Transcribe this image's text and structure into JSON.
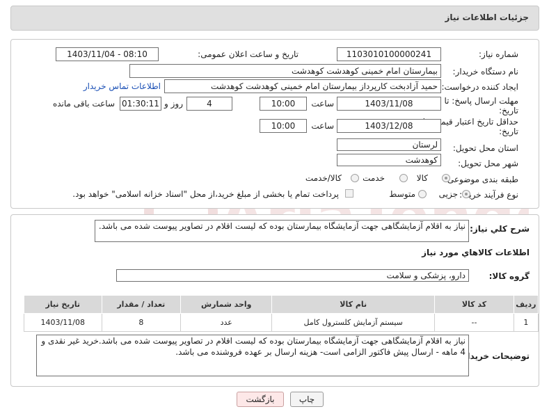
{
  "header": {
    "title": "جزئیات اطلاعات نیاز"
  },
  "form": {
    "need_number": {
      "label": "شماره نیاز:",
      "value": "1103010100000241"
    },
    "announce_datetime": {
      "label": "تاریخ و ساعت اعلان عمومی:",
      "value": "1403/11/04 - 08:10"
    },
    "buyer_org": {
      "label": "نام دستگاه خریدار:",
      "value": "بیمارستان امام خمینی کوهدشت کوهدشت"
    },
    "requester": {
      "label": "ایجاد کننده درخواست:",
      "value": "حمید آزادبخت کارپرداز بیمارستان امام خمینی کوهدشت کوهدشت",
      "contact_link": "اطلاعات تماس خریدار"
    },
    "reply_deadline": {
      "label_line1": "مهلت ارسال پاسخ: تا",
      "label_line2": "تاریخ:",
      "date": "1403/11/08",
      "time_label": "ساعت",
      "time": "10:00",
      "days": "4",
      "days_label": "روز و",
      "remaining": "01:30:11",
      "remaining_label": "ساعت باقی مانده"
    },
    "price_validity": {
      "label_line1": "حداقل تاریخ اعتبار قیمت: تا",
      "label_line2": "تاریخ:",
      "date": "1403/12/08",
      "time_label": "ساعت",
      "time": "10:00"
    },
    "province": {
      "label": "استان محل تحویل:",
      "value": "لرستان"
    },
    "city": {
      "label": "شهر محل تحویل:",
      "value": "کوهدشت"
    },
    "category": {
      "label": "طبقه بندی موضوعی:",
      "options": [
        "کالا",
        "خدمت",
        "کالا/خدمت"
      ],
      "selected": "کالا"
    },
    "purchase_type": {
      "label": "نوع فرآیند خرید :",
      "options": [
        "جزیی",
        "متوسط"
      ],
      "selected": "جزیی",
      "payment_note": "پرداخت تمام یا بخشی از مبلغ خرید،از محل \"اسناد خزانه اسلامی\" خواهد بود."
    }
  },
  "summary": {
    "label": "شرح کلي نياز:",
    "value": "نیاز به اقلام آزمایشگاهی جهت آزمایشگاه بیمارستان بوده که لیست اقلام در تصاویر پیوست شده می باشد."
  },
  "goods": {
    "section_title": "اطلاعات کالاهاي مورد نياز",
    "group_label": "گروه کالا:",
    "group_value": "دارو، پزشکی و سلامت",
    "columns": [
      "رديف",
      "کد کالا",
      "نام کالا",
      "واحد شمارش",
      "تعداد / مقدار",
      "تاريخ نياز"
    ],
    "rows": [
      [
        "1",
        "--",
        "سیستم آزمایش کلسترول کامل",
        "عدد",
        "8",
        "1403/11/08"
      ]
    ]
  },
  "buyer_notes": {
    "label": "توضیحات خریدار:",
    "value": "نیاز به اقلام آزمایشگاهی جهت آزمایشگاه بیمارستان بوده که لیست اقلام در تصاویر پیوست شده می باشد.خرید غیر نقدی و 4 ماهه - ارسال پیش فاکتور الزامی است- هزینه ارسال بر عهده فروشنده می باشد."
  },
  "buttons": {
    "print": "چاپ",
    "back": "بازگشت"
  },
  "watermark": {
    "text": "AriaTender.neT"
  },
  "colors": {
    "header_bg": "#e0e0e0",
    "table_header_bg": "#d9d9d9",
    "link": "#1a4fb5",
    "back_button_bg": "#fde8e8",
    "watermark": "#f3dede"
  }
}
